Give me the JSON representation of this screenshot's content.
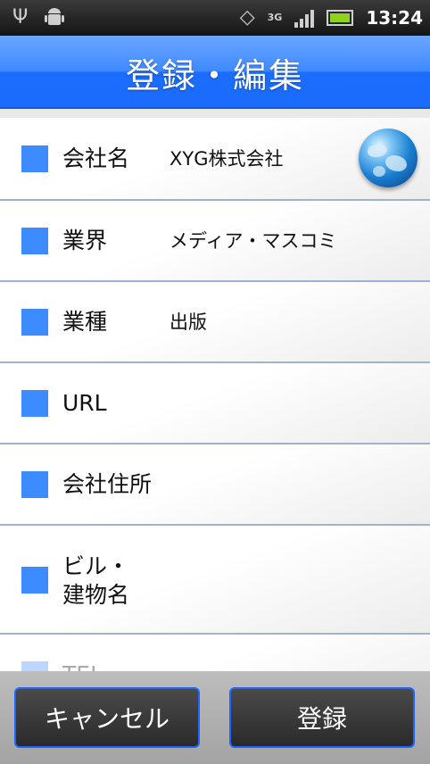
{
  "status_bar": {
    "time": "13:24",
    "network": "3G",
    "icons": [
      "usb-icon",
      "android-debug-icon",
      "rotate-icon",
      "signal-icon",
      "battery-icon"
    ]
  },
  "header": {
    "title": "登録・編集"
  },
  "form": {
    "rows": [
      {
        "label": "会社名",
        "value": "XYG株式会社"
      },
      {
        "label": "業界",
        "value": "メディア・マスコミ"
      },
      {
        "label": "業種",
        "value": "出版"
      },
      {
        "label": "URL",
        "value": ""
      },
      {
        "label": "会社住所",
        "value": ""
      },
      {
        "label": "ビル・\n建物名",
        "value": ""
      },
      {
        "label": "TEL",
        "value": ""
      }
    ]
  },
  "buttons": {
    "cancel": "キャンセル",
    "register": "登録"
  },
  "colors": {
    "accent": "#3d8cff",
    "header": "#1b6cfb",
    "button_border": "#1c66ff"
  }
}
